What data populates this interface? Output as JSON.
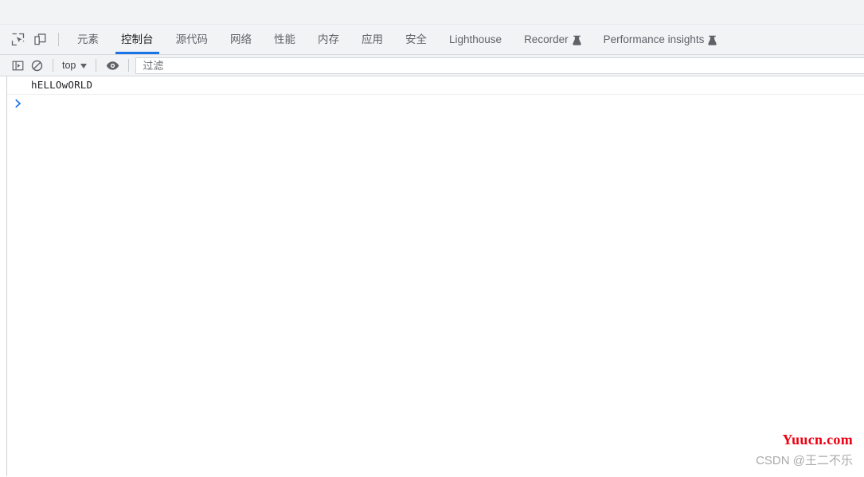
{
  "window": {
    "background_color": "#ffffff",
    "titlebar_color": "#f1f3f4"
  },
  "devtools": {
    "accent_color": "#1a73e8",
    "toolbar_icons": [
      {
        "name": "inspect-element-icon",
        "tooltip": "Inspect"
      },
      {
        "name": "device-toolbar-icon",
        "tooltip": "Toggle device toolbar"
      }
    ],
    "tabs": [
      {
        "label": "元素",
        "active": false,
        "experimental": false
      },
      {
        "label": "控制台",
        "active": true,
        "experimental": false
      },
      {
        "label": "源代码",
        "active": false,
        "experimental": false
      },
      {
        "label": "网络",
        "active": false,
        "experimental": false
      },
      {
        "label": "性能",
        "active": false,
        "experimental": false
      },
      {
        "label": "内存",
        "active": false,
        "experimental": false
      },
      {
        "label": "应用",
        "active": false,
        "experimental": false
      },
      {
        "label": "安全",
        "active": false,
        "experimental": false
      },
      {
        "label": "Lighthouse",
        "active": false,
        "experimental": false
      },
      {
        "label": "Recorder",
        "active": false,
        "experimental": true
      },
      {
        "label": "Performance insights",
        "active": false,
        "experimental": true
      }
    ]
  },
  "console_toolbar": {
    "sidebar_toggle": {
      "name": "console-sidebar-toggle-icon",
      "label": ""
    },
    "clear_button": {
      "name": "clear-console-icon",
      "label": ""
    },
    "context": {
      "value": "top",
      "caret": "▼"
    },
    "eye_button": {
      "name": "live-expression-eye-icon",
      "label": ""
    },
    "filter": {
      "value": "",
      "placeholder": "过滤"
    }
  },
  "console": {
    "messages": [
      {
        "text": "hELLOwORLD",
        "level": "log"
      }
    ],
    "prompt_symbol": ">",
    "prompt_value": ""
  },
  "watermark": {
    "site": "Yuucn.com",
    "site_color": "#ee0011",
    "user": "CSDN @王二不乐",
    "user_color": "#aaaaaa"
  }
}
